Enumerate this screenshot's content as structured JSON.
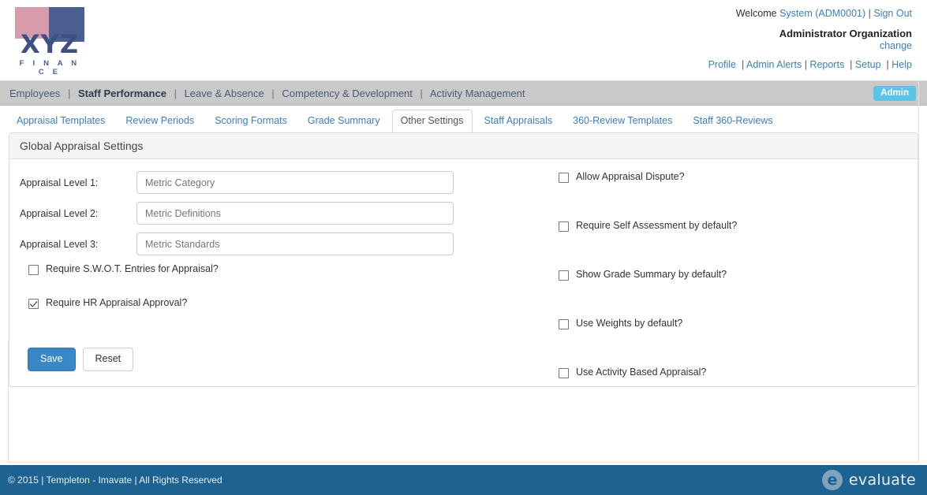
{
  "header": {
    "logo": {
      "wordmark": "XYZ",
      "tagline": "F I N A N C E",
      "pink_hex": "#d79cab",
      "blue_hex": "#4a5e92"
    },
    "welcome_label": "Welcome",
    "user_name": "System (ADM0001)",
    "sign_out": "Sign Out",
    "organization": "Administrator Organization",
    "change_link": "change",
    "links": [
      "Profile",
      "Admin Alerts",
      "Reports",
      "Setup",
      "Help"
    ]
  },
  "mainnav": {
    "items": [
      {
        "label": "Employees",
        "active": false
      },
      {
        "label": "Staff Performance",
        "active": true
      },
      {
        "label": "Leave & Absence",
        "active": false
      },
      {
        "label": "Competency & Development",
        "active": false
      },
      {
        "label": "Activity Management",
        "active": false
      }
    ],
    "badge": "Admin",
    "badge_hex": "#5bc4e8",
    "bar_hex": "#c9c9c9"
  },
  "tabs": [
    {
      "label": "Appraisal Templates",
      "active": false
    },
    {
      "label": "Review Periods",
      "active": false
    },
    {
      "label": "Scoring Formats",
      "active": false
    },
    {
      "label": "Grade Summary",
      "active": false
    },
    {
      "label": "Other Settings",
      "active": true
    },
    {
      "label": "Staff Appraisals",
      "active": false
    },
    {
      "label": "360-Review Templates",
      "active": false
    },
    {
      "label": "Staff 360-Reviews",
      "active": false
    }
  ],
  "panel": {
    "title": "Global Appraisal Settings",
    "fields": [
      {
        "label": "Appraisal Level 1:",
        "value": "Metric Category"
      },
      {
        "label": "Appraisal Level 2:",
        "value": "Metric Definitions"
      },
      {
        "label": "Appraisal Level 3:",
        "value": "Metric Standards"
      }
    ],
    "left_checkboxes": [
      {
        "label": "Require S.W.O.T. Entries for Appraisal?",
        "checked": false
      },
      {
        "label": "Require HR Appraisal Approval?",
        "checked": true
      }
    ],
    "right_checkboxes": [
      {
        "label": "Allow Appraisal Dispute?",
        "checked": false
      },
      {
        "label": "Require Self Assessment by default?",
        "checked": false
      },
      {
        "label": "Show Grade Summary by default?",
        "checked": false
      },
      {
        "label": "Use Weights by default?",
        "checked": false
      },
      {
        "label": "Use Activity Based Appraisal?",
        "checked": false
      }
    ],
    "save_label": "Save",
    "reset_label": "Reset",
    "save_hex": "#3a87c8"
  },
  "footer": {
    "copyright": "© 2015 | Templeton - Imavate | All Rights Reserved",
    "brand": "evaluate",
    "bar_hex": "#1d6291"
  }
}
